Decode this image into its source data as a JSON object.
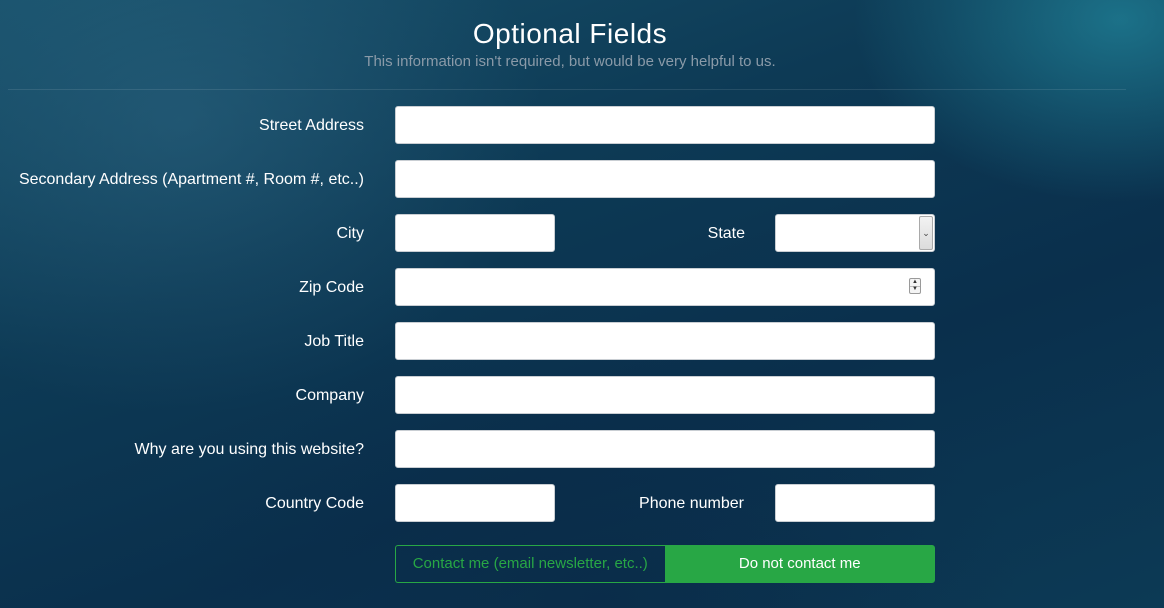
{
  "header": {
    "title": "Optional Fields",
    "subtitle": "This information isn't required, but would be very helpful to us."
  },
  "form": {
    "street_address": {
      "label": "Street Address",
      "value": ""
    },
    "secondary_address": {
      "label": "Secondary Address (Apartment #, Room #, etc..)",
      "value": ""
    },
    "city": {
      "label": "City",
      "value": ""
    },
    "state": {
      "label": "State",
      "value": ""
    },
    "zip_code": {
      "label": "Zip Code",
      "value": ""
    },
    "job_title": {
      "label": "Job Title",
      "value": ""
    },
    "company": {
      "label": "Company",
      "value": ""
    },
    "why_using": {
      "label": "Why are you using this website?",
      "value": ""
    },
    "country_code": {
      "label": "Country Code",
      "value": ""
    },
    "phone_number": {
      "label": "Phone number",
      "value": ""
    }
  },
  "contact_toggle": {
    "contact_label": "Contact me (email newsletter, etc..)",
    "no_contact_label": "Do not contact me",
    "selected": "Do not contact me"
  },
  "colors": {
    "accent_green": "#28a745",
    "subtitle_gray": "#8a9aa8"
  },
  "icons": {
    "select_arrow": "chevron-down-icon",
    "spinner": "number-spinner-icon"
  }
}
